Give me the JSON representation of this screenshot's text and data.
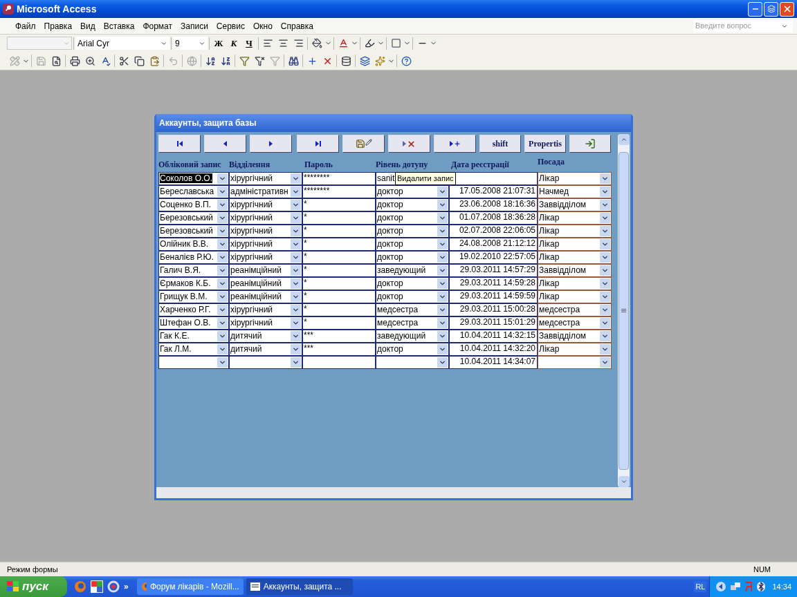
{
  "app_title": "Microsoft Access",
  "menu": [
    "Файл",
    "Правка",
    "Вид",
    "Вставка",
    "Формат",
    "Записи",
    "Сервис",
    "Окно",
    "Справка"
  ],
  "help_search": {
    "placeholder": "Введите вопрос"
  },
  "format_toolbar": {
    "font": "Arial Cyr",
    "size": "9",
    "bold": "Ж",
    "italic": "К",
    "underline": "Ч"
  },
  "form": {
    "title": "Аккаунты, защита базы",
    "nav_buttons": [
      {
        "kind": "first"
      },
      {
        "kind": "prev"
      },
      {
        "kind": "next"
      },
      {
        "kind": "last"
      },
      {
        "kind": "save"
      },
      {
        "kind": "delete"
      },
      {
        "kind": "new"
      },
      {
        "kind": "text",
        "label": "shift"
      },
      {
        "kind": "text",
        "label": "Propertis"
      },
      {
        "kind": "exit"
      }
    ],
    "columns": [
      "Обліковий запис",
      "Відділення",
      "Пароль",
      "Рівень дотупу",
      "Дата реєстрації",
      "Посада"
    ],
    "rows": [
      {
        "account": "Соколов О.О.",
        "department": "хірургічний",
        "password": "********",
        "level": "sanit",
        "post": "Лікар",
        "selected": true
      },
      {
        "account": "Береславська",
        "department": "адміністративн",
        "password": "********",
        "level": "доктор",
        "date": "17.05.2008 21:07:31",
        "post": "Начмед",
        "selected": false
      },
      {
        "account": "Соценко В.П.",
        "department": "хірургічний",
        "password": "*",
        "level": "доктор",
        "date": "23.06.2008 18:16:36",
        "post": "Заввідділом",
        "selected": false
      },
      {
        "account": "Березовський",
        "department": "хірургічний",
        "password": "*",
        "level": "доктор",
        "date": "01.07.2008 18:36:28",
        "post": "Лікар",
        "selected": false
      },
      {
        "account": "Березовський",
        "department": "хірургічний",
        "password": "*",
        "level": "доктор",
        "date": "02.07.2008 22:06:05",
        "post": "Лікар",
        "selected": false
      },
      {
        "account": "Олійник В.В.",
        "department": "хірургічний",
        "password": "*",
        "level": "доктор",
        "date": "24.08.2008 21:12:12",
        "post": "Лікар",
        "selected": false
      },
      {
        "account": "Беналієв Р.Ю.",
        "department": "хірургічний",
        "password": "*",
        "level": "доктор",
        "date": "19.02.2010 22:57:05",
        "post": "Лікар",
        "selected": false
      },
      {
        "account": "Галич В.Я.",
        "department": "реанімційний",
        "password": "*",
        "level": "заведующий",
        "date": "29.03.2011 14:57:29",
        "post": "Заввідділом",
        "selected": false
      },
      {
        "account": "Єрмаков К.Б.",
        "department": "реанімційний",
        "password": "*",
        "level": "доктор",
        "date": "29.03.2011 14:59:28",
        "post": "Лікар",
        "selected": false
      },
      {
        "account": "Грищук В.М.",
        "department": "реанімційний",
        "password": "*",
        "level": "доктор",
        "date": "29.03.2011 14:59:59",
        "post": "Лікар",
        "selected": false
      },
      {
        "account": "Харченко Р.Г.",
        "department": "хірургічний",
        "password": "*",
        "level": "медсестра",
        "date": "29.03.2011 15:00:28",
        "post": "медсестра",
        "selected": false
      },
      {
        "account": "Штефан О.В.",
        "department": "хірургічний",
        "password": "*",
        "level": "медсестра",
        "date": "29.03.2011 15:01:29",
        "post": "медсестра",
        "selected": false
      },
      {
        "account": "Гак К.Е.",
        "department": "дитячий",
        "password": "***",
        "level": "заведующий",
        "date": "10.04.2011 14:32:15",
        "post": "Заввідділом",
        "selected": false
      },
      {
        "account": "Гак Л.М.",
        "department": "дитячий",
        "password": "***",
        "level": "доктор",
        "date": "10.04.2011 14:32:20",
        "post": "Лікар",
        "selected": false
      },
      {
        "date": "10.04.2011 14:34:07",
        "selected": false
      }
    ],
    "tooltip": "Видалити запис"
  },
  "status_bar": {
    "mode": "Режим формы",
    "indicator": "NUM"
  },
  "taskbar": {
    "start": "пуск",
    "overflow": "»",
    "tasks": [
      {
        "label": "Форум лікарів - Mozill...",
        "kind": "browser",
        "selected": false
      },
      {
        "label": "Аккаунты, защита ...",
        "kind": "form",
        "selected": true
      }
    ],
    "language": "RL",
    "clock": "14:34"
  }
}
